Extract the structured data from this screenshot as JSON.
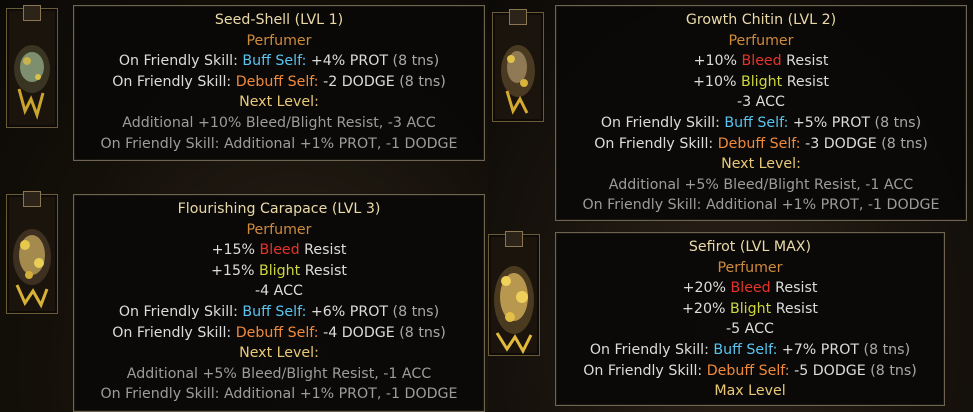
{
  "trinkets": [
    {
      "title": "Seed-Shell (LVL 1)",
      "class": "Perfumer",
      "effects": [
        {
          "prefix": "On Friendly Skill:",
          "key": "Buff Self:",
          "value": "+4% PROT",
          "dur": "(8 tns)"
        },
        {
          "prefix": "On Friendly Skill:",
          "key": "Debuff Self:",
          "value": "-2 DODGE",
          "dur": "(8 tns)"
        }
      ],
      "next_label": "Next Level:",
      "next_lines": [
        "Additional +10% Bleed/Blight Resist, -3 ACC",
        "On Friendly Skill: Additional +1% PROT, -1 DODGE"
      ]
    },
    {
      "title": "Growth Chitin (LVL 2)",
      "class": "Perfumer",
      "resists": [
        {
          "value": "+10%",
          "name": "Bleed",
          "suffix": "Resist"
        },
        {
          "value": "+10%",
          "name": "Blight",
          "suffix": "Resist"
        }
      ],
      "acc": "-3 ACC",
      "effects": [
        {
          "prefix": "On Friendly Skill:",
          "key": "Buff Self:",
          "value": "+5% PROT",
          "dur": "(8 tns)"
        },
        {
          "prefix": "On Friendly Skill:",
          "key": "Debuff Self:",
          "value": "-3 DODGE",
          "dur": "(8 tns)"
        }
      ],
      "next_label": "Next Level:",
      "next_lines": [
        "Additional +5% Bleed/Blight Resist, -1 ACC",
        "On Friendly Skill: Additional +1% PROT, -1 DODGE"
      ]
    },
    {
      "title": "Flourishing Carapace (LVL 3)",
      "class": "Perfumer",
      "resists": [
        {
          "value": "+15%",
          "name": "Bleed",
          "suffix": "Resist"
        },
        {
          "value": "+15%",
          "name": "Blight",
          "suffix": "Resist"
        }
      ],
      "acc": "-4 ACC",
      "effects": [
        {
          "prefix": "On Friendly Skill:",
          "key": "Buff Self:",
          "value": "+6% PROT",
          "dur": "(8 tns)"
        },
        {
          "prefix": "On Friendly Skill:",
          "key": "Debuff Self:",
          "value": "-4 DODGE",
          "dur": "(8 tns)"
        }
      ],
      "next_label": "Next Level:",
      "next_lines": [
        "Additional +5% Bleed/Blight Resist, -1 ACC",
        "On Friendly Skill: Additional +1% PROT, -1 DODGE"
      ]
    },
    {
      "title": "Sefirot (LVL MAX)",
      "class": "Perfumer",
      "resists": [
        {
          "value": "+20%",
          "name": "Bleed",
          "suffix": "Resist"
        },
        {
          "value": "+20%",
          "name": "Blight",
          "suffix": "Resist"
        }
      ],
      "acc": "-5 ACC",
      "effects": [
        {
          "prefix": "On Friendly Skill:",
          "key": "Buff Self:",
          "value": "+7% PROT",
          "dur": "(8 tns)"
        },
        {
          "prefix": "On Friendly Skill:",
          "key": "Debuff Self:",
          "value": "-5 DODGE",
          "dur": "(8 tns)"
        }
      ],
      "max_label": "Max Level"
    }
  ],
  "icons": [
    "seed-shell-trinket-icon",
    "growth-chitin-trinket-icon",
    "flourishing-carapace-trinket-icon",
    "sefirot-trinket-icon"
  ],
  "colors": {
    "title": "#ead9a8",
    "class": "#ce8a3d",
    "buff": "#59c4f0",
    "debuff": "#f08a3c",
    "bleed": "#e5342a",
    "blight": "#cdd83e",
    "next_level": "#e8c977",
    "muted": "#9c9c9c",
    "border": "#6d6452"
  }
}
